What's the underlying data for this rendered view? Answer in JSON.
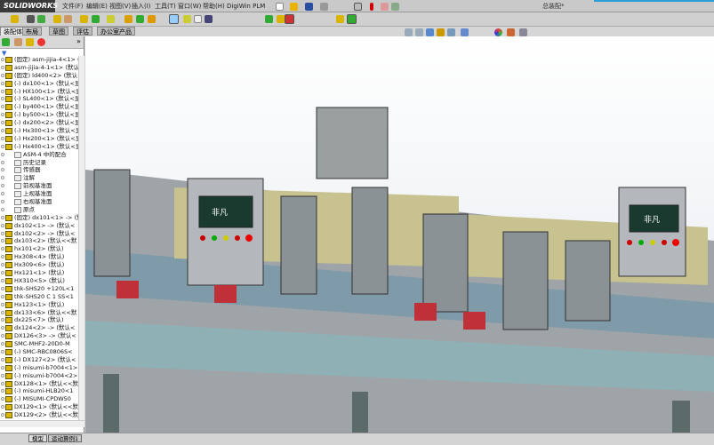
{
  "app": {
    "logo": "SOLIDWORKS",
    "title": "总装配*"
  },
  "menu": [
    "文件(F)",
    "编辑(E)",
    "视图(V)",
    "插入(I)",
    "工具(T)",
    "窗口(W)",
    "帮助(H)",
    "DigiWin PLM"
  ],
  "tabs": [
    {
      "label": "装配体",
      "active": true
    },
    {
      "label": "布局"
    },
    {
      "label": "草图"
    },
    {
      "label": "评估"
    },
    {
      "label": "办公室产品"
    }
  ],
  "tree": [
    {
      "label": "(固定) asm-jijia-4<1> (默"
    },
    {
      "label": "asm-jijia-4-1<1> (默认<"
    },
    {
      "label": "(固定) ld400<2> (默认<-"
    },
    {
      "label": "(-) dx100<1> (默认<显示"
    },
    {
      "label": "(-) HX100<1> (默认<显示"
    },
    {
      "label": "(-) SL400<1> (默认<显示"
    },
    {
      "label": "(-) by400<1> (默认<显示"
    },
    {
      "label": "(-) by500<1> (默认<显示"
    },
    {
      "label": "(-) dx200<2> (默认<显示"
    },
    {
      "label": "(-) Hx300<1> (默认<显示"
    },
    {
      "label": "(-) Hx200<1> (默认<显示"
    },
    {
      "label": "(-) Hx400<1> (默认<显示"
    },
    {
      "label": "ASM-4 中的配合",
      "sub": true
    },
    {
      "label": "历史记录",
      "sub": true
    },
    {
      "label": "传感器",
      "sub": true
    },
    {
      "label": "注解",
      "sub": true
    },
    {
      "label": "前视基准面",
      "sub": true
    },
    {
      "label": "上视基准面",
      "sub": true
    },
    {
      "label": "右视基准面",
      "sub": true
    },
    {
      "label": "原点",
      "sub": true
    },
    {
      "label": "(固定) dx101<1> -> (默"
    },
    {
      "label": "dx102<1> -> (默认<"
    },
    {
      "label": "dx102<2> -> (默认<"
    },
    {
      "label": "dx103<2> (默认<<默"
    },
    {
      "label": "hx101<2> (默认)"
    },
    {
      "label": "Hx308<4> (默认)"
    },
    {
      "label": "Hx309<6> (默认)"
    },
    {
      "label": "Hx121<1> (默认)"
    },
    {
      "label": "HX310<5> (默认)"
    },
    {
      "label": "thk-SHS20 +120L<1"
    },
    {
      "label": "thk-SHS20 C 1 SS<1"
    },
    {
      "label": "Hx123<1> (默认)"
    },
    {
      "label": "dx133<6> (默认<<默"
    },
    {
      "label": "dx225<7> (默认)"
    },
    {
      "label": "dx124<2> -> (默认<"
    },
    {
      "label": "DX126<3> -> (默认<"
    },
    {
      "label": "SMC-MHF2-20D0-M"
    },
    {
      "label": "(-) SMC-RBC0806S<"
    },
    {
      "label": "(-) DX127<2> (默认<"
    },
    {
      "label": "(-) misumi-b7004<1>"
    },
    {
      "label": "(-) misumi-b7004<2>"
    },
    {
      "label": "DX128<1> (默认<<默"
    },
    {
      "label": "(-) misumi-HLB20<1"
    },
    {
      "label": "(-) MISUMI-CPDW50"
    },
    {
      "label": "DX129<1> (默认<<默"
    },
    {
      "label": "DX129<2> (默认<<默"
    }
  ],
  "bottom_tabs": [
    "模型",
    "运动算例1"
  ],
  "viewport": {
    "hmi_label": "非凡"
  }
}
